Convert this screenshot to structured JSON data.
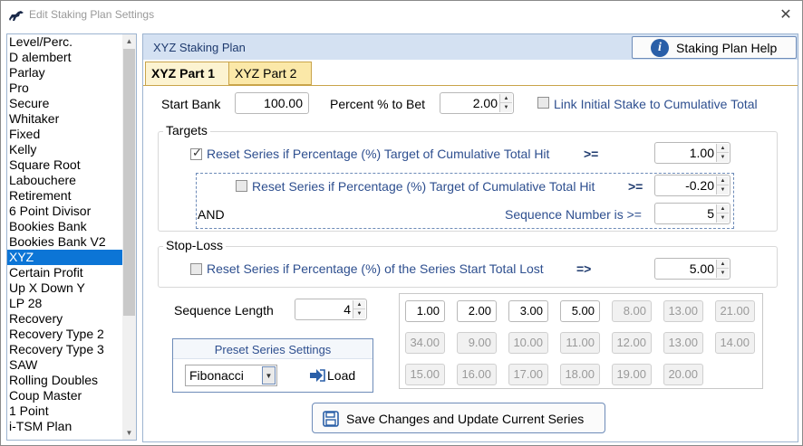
{
  "window": {
    "title": "Edit Staking Plan Settings",
    "close_glyph": "✕"
  },
  "sidebar": {
    "items": [
      "Level/Perc.",
      "D alembert",
      "Parlay",
      "Pro",
      "Secure",
      "Whitaker",
      "Fixed",
      "Kelly",
      "Square Root",
      "Labouchere",
      "Retirement",
      "6 Point Divisor",
      "Bookies Bank",
      "Bookies Bank V2",
      "XYZ",
      "Certain Profit",
      "Up X Down Y",
      "LP 28",
      "Recovery",
      "Recovery Type 2",
      "Recovery Type 3",
      "SAW",
      "Rolling Doubles",
      "Coup Master",
      "1 Point",
      "i-TSM Plan"
    ],
    "selected_index": 14
  },
  "main": {
    "header_title": "XYZ Staking Plan",
    "help_button": "Staking Plan Help",
    "tabs": [
      "XYZ Part 1",
      "XYZ Part 2"
    ],
    "active_tab": 0
  },
  "part1": {
    "start_bank_label": "Start Bank",
    "start_bank_value": "100.00",
    "percent_label": "Percent % to Bet",
    "percent_value": "2.00",
    "link_label": "Link Initial Stake to Cumulative Total",
    "link_checked": false,
    "targets": {
      "title": "Targets",
      "reset1_label": "Reset Series if Percentage (%) Target of Cumulative Total Hit",
      "reset1_op": ">=",
      "reset1_checked": true,
      "reset1_value": "1.00",
      "reset2_label": "Reset Series if Percentage (%) Target of Cumulative Total Hit",
      "reset2_op": ">=",
      "reset2_checked": false,
      "reset2_value": "-0.20",
      "and_label": "AND",
      "seq_label": "Sequence Number is >=",
      "seq_value": "5"
    },
    "stoploss": {
      "title": "Stop-Loss",
      "label": "Reset Series if Percentage (%) of the Series Start Total Lost",
      "op": "=>",
      "checked": false,
      "value": "5.00"
    },
    "sequence_length_label": "Sequence Length",
    "sequence_length_value": "4",
    "series_values": [
      "1.00",
      "2.00",
      "3.00",
      "5.00",
      "8.00",
      "13.00",
      "21.00",
      "34.00",
      "9.00",
      "10.00",
      "11.00",
      "12.00",
      "13.00",
      "14.00",
      "15.00",
      "16.00",
      "17.00",
      "18.00",
      "19.00",
      "20.00"
    ],
    "preset": {
      "title": "Preset Series Settings",
      "selected": "Fibonacci",
      "load_label": "Load"
    },
    "save_button": "Save Changes and Update Current Series"
  }
}
